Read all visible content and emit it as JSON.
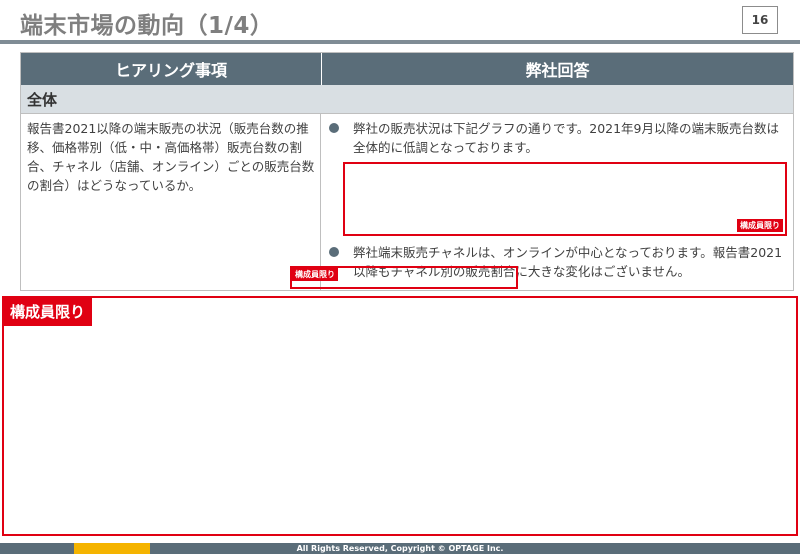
{
  "header": {
    "title": "端末市場の動向（1/4）",
    "page_number": "16"
  },
  "table": {
    "col_left_header": "ヒアリング事項",
    "col_right_header": "弊社回答",
    "section_label": "全体",
    "question": "報告書2021以降の端末販売の状況（販売台数の推移、価格帯別（低・中・高価格帯）販売台数の割合、チャネル（店舗、オンライン）ごとの販売台数の割合）はどうなっているか。",
    "answers": [
      "弊社の販売状況は下記グラフの通りです。2021年9月以降の端末販売台数は全体的に低調となっております。",
      "弊社端末販売チャネルは、オンラインが中心となっております。報告書2021以降もチャネル別の販売割合に大きな変化はございません。"
    ],
    "redacted_tag_1": "構成員限り",
    "redacted_tag_2": "構成員限り"
  },
  "redacted_panel": {
    "tag": "構成員限り"
  },
  "footer": {
    "copyright": "All Rights Reserved, Copyright © OPTAGE Inc."
  },
  "colors": {
    "header_fill": "#5a6d79",
    "section_fill": "#d9dfe3",
    "redaction_red": "#e00012",
    "footer_accent": "#f5b400"
  }
}
